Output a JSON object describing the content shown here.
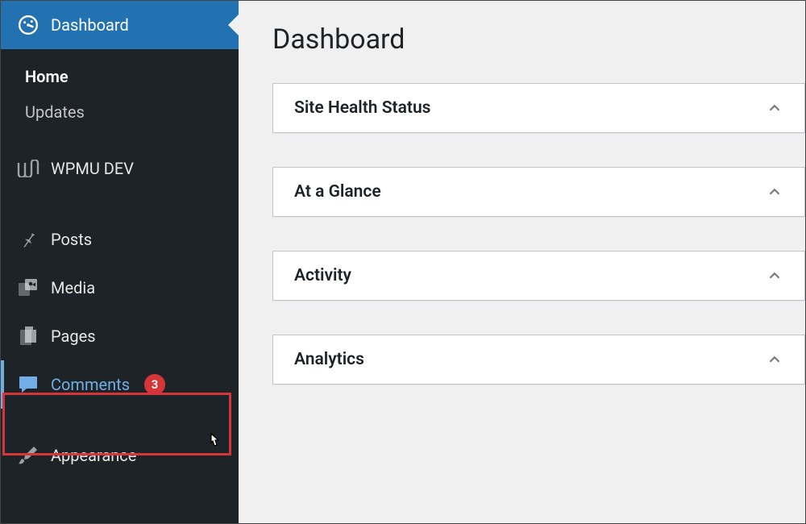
{
  "page": {
    "title": "Dashboard"
  },
  "sidebar": {
    "dashboard": {
      "label": "Dashboard"
    },
    "submenu": {
      "home": "Home",
      "updates": "Updates"
    },
    "wpmu": {
      "label": "WPMU DEV"
    },
    "posts": {
      "label": "Posts"
    },
    "media": {
      "label": "Media"
    },
    "pages": {
      "label": "Pages"
    },
    "comments": {
      "label": "Comments",
      "badge": "3"
    },
    "appearance": {
      "label": "Appearance"
    }
  },
  "panels": {
    "site_health": "Site Health Status",
    "at_a_glance": "At a Glance",
    "activity": "Activity",
    "analytics": "Analytics"
  }
}
